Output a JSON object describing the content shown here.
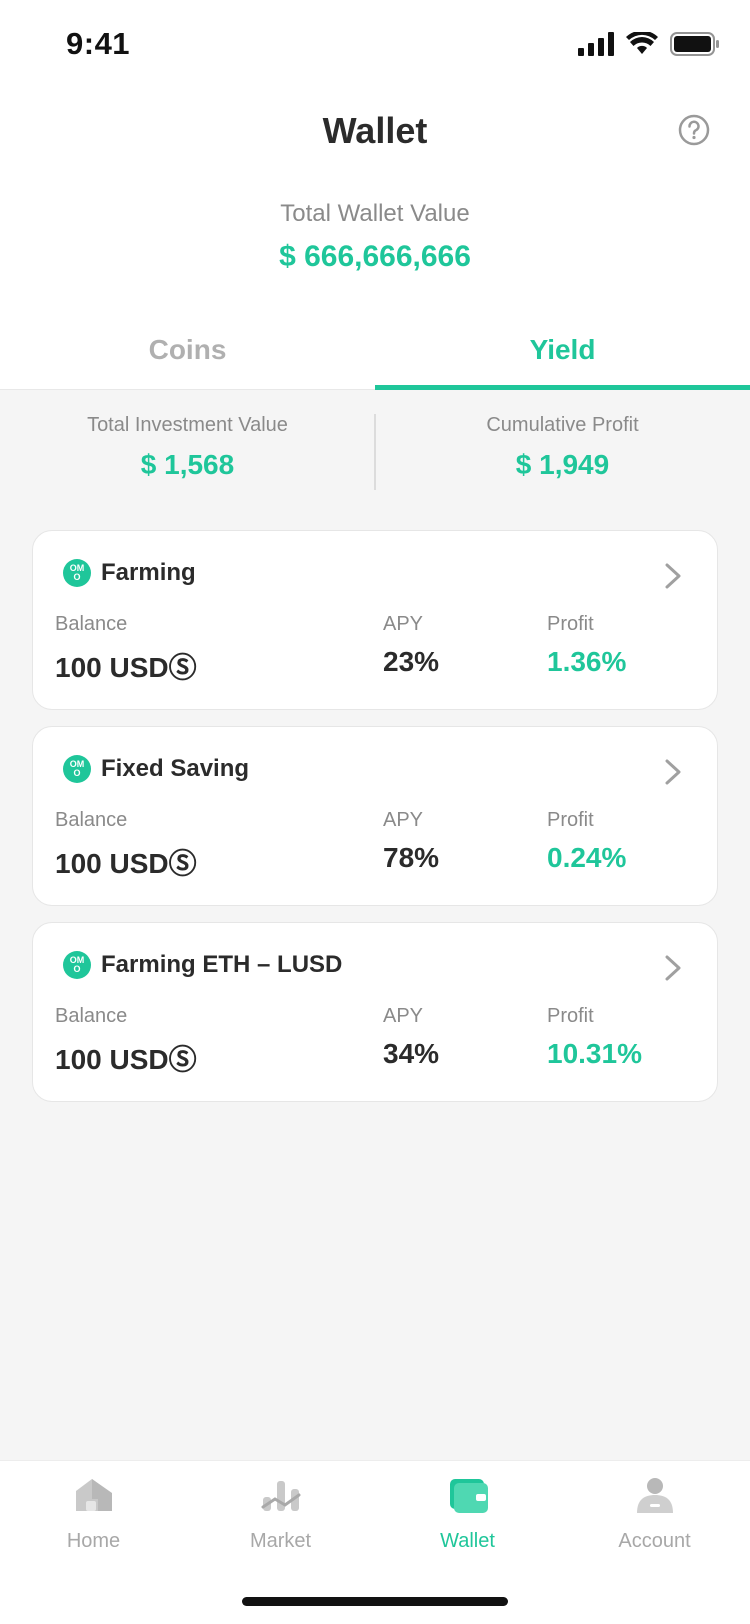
{
  "status_bar": {
    "time": "9:41"
  },
  "header": {
    "title": "Wallet",
    "help_icon": "help-circle-icon"
  },
  "total_wallet": {
    "label": "Total Wallet Value",
    "value": "$ 666,666,666"
  },
  "tabs": [
    {
      "label": "Coins",
      "active": false
    },
    {
      "label": "Yield",
      "active": true
    }
  ],
  "summary": {
    "investment_label": "Total Investment Value",
    "investment_value": "$ 1,568",
    "profit_label": "Cumulative Profit",
    "profit_value": "$ 1,949"
  },
  "cards": [
    {
      "title": "Farming",
      "logo_text": "OM O",
      "balance_label": "Balance",
      "balance": "100 USDⓈ",
      "apy_label": "APY",
      "apy": "23%",
      "profit_label": "Profit",
      "profit": "1.36%"
    },
    {
      "title": "Fixed Saving",
      "logo_text": "OM O",
      "balance_label": "Balance",
      "balance": "100 USDⓈ",
      "apy_label": "APY",
      "apy": "78%",
      "profit_label": "Profit",
      "profit": "0.24%"
    },
    {
      "title": "Farming ETH – LUSD",
      "logo_text": "OM O",
      "balance_label": "Balance",
      "balance": "100 USDⓈ",
      "apy_label": "APY",
      "apy": "34%",
      "profit_label": "Profit",
      "profit": "10.31%"
    }
  ],
  "nav": [
    {
      "label": "Home",
      "icon": "home-icon",
      "active": false
    },
    {
      "label": "Market",
      "icon": "market-icon",
      "active": false
    },
    {
      "label": "Wallet",
      "icon": "wallet-icon",
      "active": true
    },
    {
      "label": "Account",
      "icon": "account-icon",
      "active": false
    }
  ],
  "colors": {
    "accent": "#1fc69a",
    "muted": "#8a8a8a",
    "text": "#2b2b2b",
    "background": "#f5f5f5"
  }
}
